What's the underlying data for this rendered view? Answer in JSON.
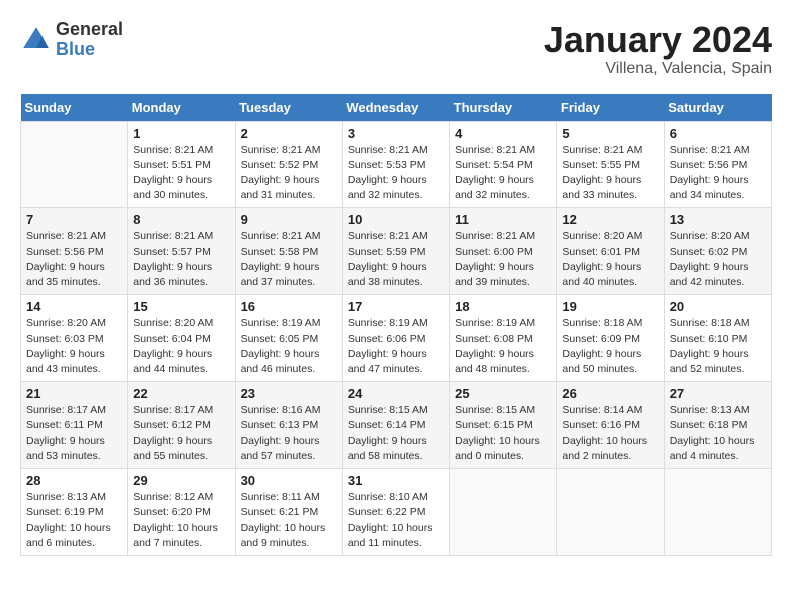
{
  "header": {
    "logo_general": "General",
    "logo_blue": "Blue",
    "title": "January 2024",
    "subtitle": "Villena, Valencia, Spain"
  },
  "weekdays": [
    "Sunday",
    "Monday",
    "Tuesday",
    "Wednesday",
    "Thursday",
    "Friday",
    "Saturday"
  ],
  "weeks": [
    [
      {
        "day": "",
        "sunrise": "",
        "sunset": "",
        "daylight": ""
      },
      {
        "day": "1",
        "sunrise": "Sunrise: 8:21 AM",
        "sunset": "Sunset: 5:51 PM",
        "daylight": "Daylight: 9 hours and 30 minutes."
      },
      {
        "day": "2",
        "sunrise": "Sunrise: 8:21 AM",
        "sunset": "Sunset: 5:52 PM",
        "daylight": "Daylight: 9 hours and 31 minutes."
      },
      {
        "day": "3",
        "sunrise": "Sunrise: 8:21 AM",
        "sunset": "Sunset: 5:53 PM",
        "daylight": "Daylight: 9 hours and 32 minutes."
      },
      {
        "day": "4",
        "sunrise": "Sunrise: 8:21 AM",
        "sunset": "Sunset: 5:54 PM",
        "daylight": "Daylight: 9 hours and 32 minutes."
      },
      {
        "day": "5",
        "sunrise": "Sunrise: 8:21 AM",
        "sunset": "Sunset: 5:55 PM",
        "daylight": "Daylight: 9 hours and 33 minutes."
      },
      {
        "day": "6",
        "sunrise": "Sunrise: 8:21 AM",
        "sunset": "Sunset: 5:56 PM",
        "daylight": "Daylight: 9 hours and 34 minutes."
      }
    ],
    [
      {
        "day": "7",
        "sunrise": "Sunrise: 8:21 AM",
        "sunset": "Sunset: 5:56 PM",
        "daylight": "Daylight: 9 hours and 35 minutes."
      },
      {
        "day": "8",
        "sunrise": "Sunrise: 8:21 AM",
        "sunset": "Sunset: 5:57 PM",
        "daylight": "Daylight: 9 hours and 36 minutes."
      },
      {
        "day": "9",
        "sunrise": "Sunrise: 8:21 AM",
        "sunset": "Sunset: 5:58 PM",
        "daylight": "Daylight: 9 hours and 37 minutes."
      },
      {
        "day": "10",
        "sunrise": "Sunrise: 8:21 AM",
        "sunset": "Sunset: 5:59 PM",
        "daylight": "Daylight: 9 hours and 38 minutes."
      },
      {
        "day": "11",
        "sunrise": "Sunrise: 8:21 AM",
        "sunset": "Sunset: 6:00 PM",
        "daylight": "Daylight: 9 hours and 39 minutes."
      },
      {
        "day": "12",
        "sunrise": "Sunrise: 8:20 AM",
        "sunset": "Sunset: 6:01 PM",
        "daylight": "Daylight: 9 hours and 40 minutes."
      },
      {
        "day": "13",
        "sunrise": "Sunrise: 8:20 AM",
        "sunset": "Sunset: 6:02 PM",
        "daylight": "Daylight: 9 hours and 42 minutes."
      }
    ],
    [
      {
        "day": "14",
        "sunrise": "Sunrise: 8:20 AM",
        "sunset": "Sunset: 6:03 PM",
        "daylight": "Daylight: 9 hours and 43 minutes."
      },
      {
        "day": "15",
        "sunrise": "Sunrise: 8:20 AM",
        "sunset": "Sunset: 6:04 PM",
        "daylight": "Daylight: 9 hours and 44 minutes."
      },
      {
        "day": "16",
        "sunrise": "Sunrise: 8:19 AM",
        "sunset": "Sunset: 6:05 PM",
        "daylight": "Daylight: 9 hours and 46 minutes."
      },
      {
        "day": "17",
        "sunrise": "Sunrise: 8:19 AM",
        "sunset": "Sunset: 6:06 PM",
        "daylight": "Daylight: 9 hours and 47 minutes."
      },
      {
        "day": "18",
        "sunrise": "Sunrise: 8:19 AM",
        "sunset": "Sunset: 6:08 PM",
        "daylight": "Daylight: 9 hours and 48 minutes."
      },
      {
        "day": "19",
        "sunrise": "Sunrise: 8:18 AM",
        "sunset": "Sunset: 6:09 PM",
        "daylight": "Daylight: 9 hours and 50 minutes."
      },
      {
        "day": "20",
        "sunrise": "Sunrise: 8:18 AM",
        "sunset": "Sunset: 6:10 PM",
        "daylight": "Daylight: 9 hours and 52 minutes."
      }
    ],
    [
      {
        "day": "21",
        "sunrise": "Sunrise: 8:17 AM",
        "sunset": "Sunset: 6:11 PM",
        "daylight": "Daylight: 9 hours and 53 minutes."
      },
      {
        "day": "22",
        "sunrise": "Sunrise: 8:17 AM",
        "sunset": "Sunset: 6:12 PM",
        "daylight": "Daylight: 9 hours and 55 minutes."
      },
      {
        "day": "23",
        "sunrise": "Sunrise: 8:16 AM",
        "sunset": "Sunset: 6:13 PM",
        "daylight": "Daylight: 9 hours and 57 minutes."
      },
      {
        "day": "24",
        "sunrise": "Sunrise: 8:15 AM",
        "sunset": "Sunset: 6:14 PM",
        "daylight": "Daylight: 9 hours and 58 minutes."
      },
      {
        "day": "25",
        "sunrise": "Sunrise: 8:15 AM",
        "sunset": "Sunset: 6:15 PM",
        "daylight": "Daylight: 10 hours and 0 minutes."
      },
      {
        "day": "26",
        "sunrise": "Sunrise: 8:14 AM",
        "sunset": "Sunset: 6:16 PM",
        "daylight": "Daylight: 10 hours and 2 minutes."
      },
      {
        "day": "27",
        "sunrise": "Sunrise: 8:13 AM",
        "sunset": "Sunset: 6:18 PM",
        "daylight": "Daylight: 10 hours and 4 minutes."
      }
    ],
    [
      {
        "day": "28",
        "sunrise": "Sunrise: 8:13 AM",
        "sunset": "Sunset: 6:19 PM",
        "daylight": "Daylight: 10 hours and 6 minutes."
      },
      {
        "day": "29",
        "sunrise": "Sunrise: 8:12 AM",
        "sunset": "Sunset: 6:20 PM",
        "daylight": "Daylight: 10 hours and 7 minutes."
      },
      {
        "day": "30",
        "sunrise": "Sunrise: 8:11 AM",
        "sunset": "Sunset: 6:21 PM",
        "daylight": "Daylight: 10 hours and 9 minutes."
      },
      {
        "day": "31",
        "sunrise": "Sunrise: 8:10 AM",
        "sunset": "Sunset: 6:22 PM",
        "daylight": "Daylight: 10 hours and 11 minutes."
      },
      {
        "day": "",
        "sunrise": "",
        "sunset": "",
        "daylight": ""
      },
      {
        "day": "",
        "sunrise": "",
        "sunset": "",
        "daylight": ""
      },
      {
        "day": "",
        "sunrise": "",
        "sunset": "",
        "daylight": ""
      }
    ]
  ]
}
